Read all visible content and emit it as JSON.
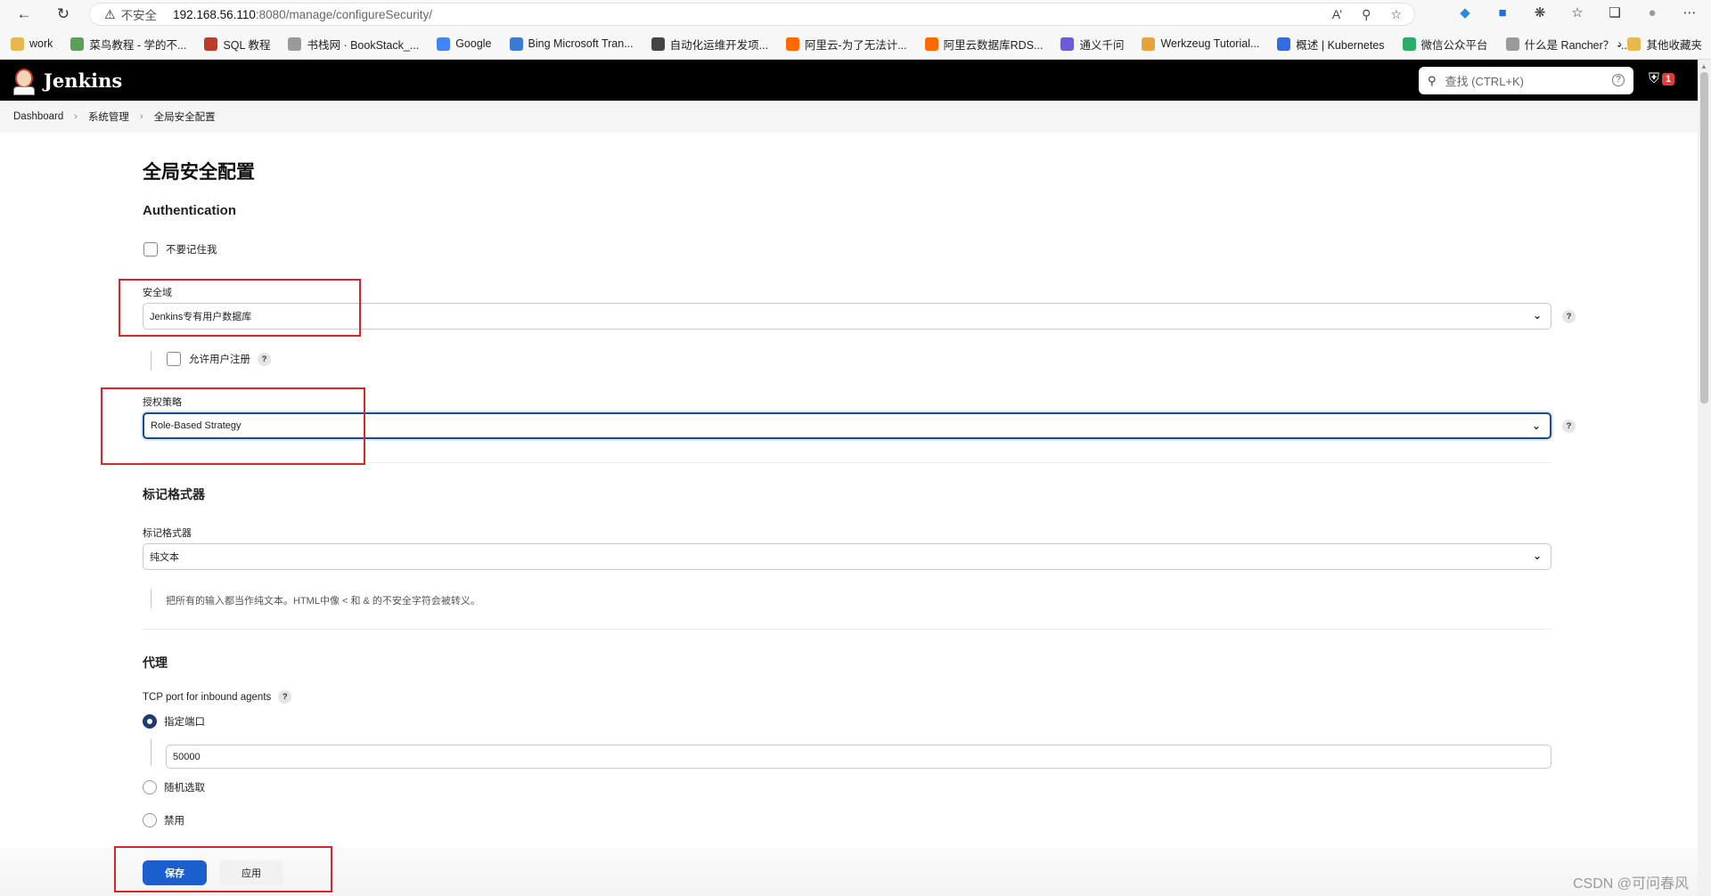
{
  "browser": {
    "back_icon": "arrow-left-icon",
    "insecure_label": "不安全",
    "url_host": "192.168.56.110",
    "url_rest": ":8080/manage/configureSecurity/",
    "bookmarks": [
      {
        "label": "work",
        "color": "#e8b84a"
      },
      {
        "label": "菜鸟教程 - 学的不...",
        "color": "#5aa05a"
      },
      {
        "label": "SQL 教程",
        "color": "#c0392b"
      },
      {
        "label": "书栈网 · BookStack_...",
        "color": "#9a9a9a"
      },
      {
        "label": "Google",
        "color": "#4285f4"
      },
      {
        "label": "Bing Microsoft Tran...",
        "color": "#3a7bd5"
      },
      {
        "label": "自动化运维开发项...",
        "color": "#444444"
      },
      {
        "label": "阿里云-为了无法计...",
        "color": "#ff6a00"
      },
      {
        "label": "阿里云数据库RDS...",
        "color": "#ff6a00"
      },
      {
        "label": "通义千问",
        "color": "#6b5bd6"
      },
      {
        "label": "Werkzeug Tutorial...",
        "color": "#e8a23a"
      },
      {
        "label": "概述 | Kubernetes",
        "color": "#326ce5"
      },
      {
        "label": "微信公众平台",
        "color": "#2aae67"
      },
      {
        "label": "什么是 Rancher？ -...",
        "color": "#9a9a9a"
      }
    ],
    "other_bookmarks": "其他收藏夹"
  },
  "header": {
    "title": "Jenkins",
    "search_placeholder": "查找 (CTRL+K)",
    "security_badge": "1"
  },
  "breadcrumb": [
    "Dashboard",
    "系统管理",
    "全局安全配置"
  ],
  "page": {
    "title": "全局安全配置",
    "authentication": {
      "heading": "Authentication",
      "remember_me_label": "不要记住我",
      "security_realm_label": "安全域",
      "security_realm_value": "Jenkins专有用户数据库",
      "allow_signup_label": "允许用户注册",
      "authorization_label": "授权策略",
      "authorization_value": "Role-Based Strategy"
    },
    "markup": {
      "heading": "标记格式器",
      "label": "标记格式器",
      "value": "纯文本",
      "hint": "把所有的输入都当作纯文本。HTML中像 < 和 & 的不安全字符会被转义。"
    },
    "agents": {
      "heading": "代理",
      "tcp_label": "TCP port for inbound agents",
      "fixed_label": "指定端口",
      "port_value": "50000",
      "random_label": "随机选取",
      "disable_label": "禁用"
    },
    "buttons": {
      "save": "保存",
      "apply": "应用"
    }
  },
  "watermark": "CSDN @可问春风"
}
